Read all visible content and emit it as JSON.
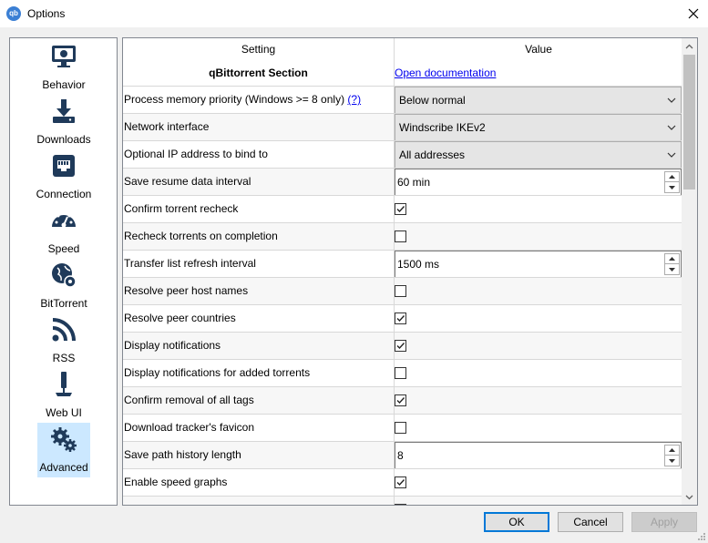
{
  "window": {
    "title": "Options",
    "app_icon_text": "qb"
  },
  "sidebar": {
    "items": [
      {
        "label": "Behavior",
        "icon": "monitor-icon"
      },
      {
        "label": "Downloads",
        "icon": "download-icon"
      },
      {
        "label": "Connection",
        "icon": "network-icon"
      },
      {
        "label": "Speed",
        "icon": "speedometer-icon"
      },
      {
        "label": "BitTorrent",
        "icon": "globe-gear-icon"
      },
      {
        "label": "RSS",
        "icon": "rss-icon"
      },
      {
        "label": "Web UI",
        "icon": "plug-icon"
      },
      {
        "label": "Advanced",
        "icon": "gears-icon"
      }
    ],
    "selected": "Advanced"
  },
  "table": {
    "headers": {
      "setting": "Setting",
      "value": "Value"
    },
    "section": {
      "title": "qBittorrent Section",
      "link": "Open documentation"
    },
    "rows": [
      {
        "setting": "Process memory priority (Windows >= 8 only)",
        "help": "(?)",
        "type": "combo",
        "value": "Below normal"
      },
      {
        "setting": "Network interface",
        "type": "combo",
        "value": "Windscribe IKEv2"
      },
      {
        "setting": "Optional IP address to bind to",
        "type": "combo",
        "value": "All addresses"
      },
      {
        "setting": "Save resume data interval",
        "type": "spin",
        "value": "60 min"
      },
      {
        "setting": "Confirm torrent recheck",
        "type": "check",
        "checked": true
      },
      {
        "setting": "Recheck torrents on completion",
        "type": "check",
        "checked": false
      },
      {
        "setting": "Transfer list refresh interval",
        "type": "spin",
        "value": "1500 ms"
      },
      {
        "setting": "Resolve peer host names",
        "type": "check",
        "checked": false
      },
      {
        "setting": "Resolve peer countries",
        "type": "check",
        "checked": true
      },
      {
        "setting": "Display notifications",
        "type": "check",
        "checked": true
      },
      {
        "setting": "Display notifications for added torrents",
        "type": "check",
        "checked": false
      },
      {
        "setting": "Confirm removal of all tags",
        "type": "check",
        "checked": true
      },
      {
        "setting": "Download tracker's favicon",
        "type": "check",
        "checked": false
      },
      {
        "setting": "Save path history length",
        "type": "spin",
        "value": "8"
      },
      {
        "setting": "Enable speed graphs",
        "type": "check",
        "checked": true
      }
    ]
  },
  "buttons": {
    "ok": "OK",
    "cancel": "Cancel",
    "apply": "Apply"
  },
  "colors": {
    "selected_bg": "#cce8ff",
    "link": "#0000ee",
    "focus": "#0078d7",
    "icon": "#1f3a5a"
  }
}
